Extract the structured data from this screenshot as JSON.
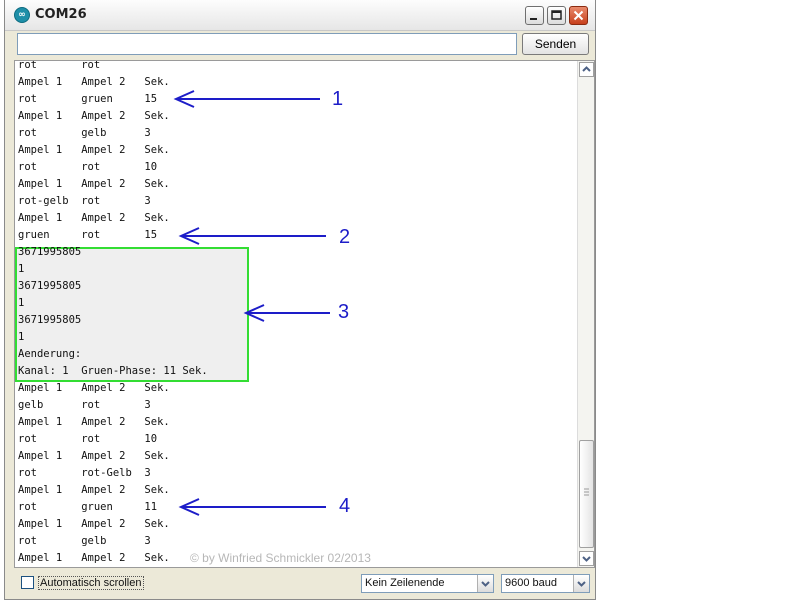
{
  "window": {
    "title": "COM26",
    "app_icon": "arduino-infinity-icon"
  },
  "serial": {
    "input_value": "",
    "send_label": "Senden"
  },
  "console": {
    "lines": [
      "rot       rot",
      "Ampel 1   Ampel 2   Sek.",
      "rot       gruen     15",
      "Ampel 1   Ampel 2   Sek.",
      "rot       gelb      3",
      "Ampel 1   Ampel 2   Sek.",
      "rot       rot       10",
      "Ampel 1   Ampel 2   Sek.",
      "rot-gelb  rot       3",
      "Ampel 1   Ampel 2   Sek.",
      "gruen     rot       15",
      "3671995805",
      "1",
      "3671995805",
      "1",
      "3671995805",
      "1",
      "Aenderung:",
      "Kanal: 1  Gruen-Phase: 11 Sek.",
      "Ampel 1   Ampel 2   Sek.",
      "gelb      rot       3",
      "Ampel 1   Ampel 2   Sek.",
      "rot       rot       10",
      "Ampel 1   Ampel 2   Sek.",
      "rot       rot-Gelb  3",
      "Ampel 1   Ampel 2   Sek.",
      "rot       gruen     11",
      "Ampel 1   Ampel 2   Sek.",
      "rot       gelb      3",
      "Ampel 1   Ampel 2   Sek."
    ],
    "watermark": "© by Winfried Schmickler 02/2013"
  },
  "footer": {
    "autoscroll_label": "Automatisch scrollen",
    "autoscroll_checked": false,
    "line_ending": "Kein Zeilenende",
    "baud": "9600 baud"
  },
  "annotations": {
    "labels": [
      "1",
      "2",
      "3",
      "4"
    ],
    "color": "#1d1dc8",
    "highlight_color": "#33dd33"
  }
}
